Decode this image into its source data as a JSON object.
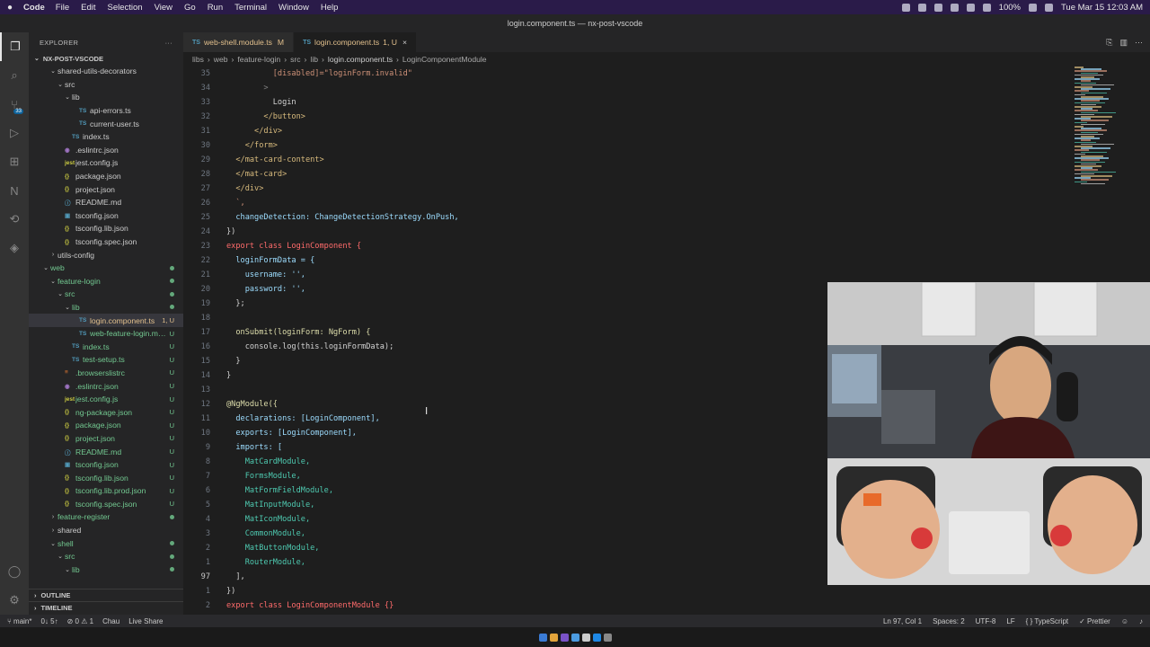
{
  "mac_menubar": {
    "app": "Code",
    "menus": [
      "File",
      "Edit",
      "Selection",
      "View",
      "Go",
      "Run",
      "Terminal",
      "Window",
      "Help"
    ],
    "battery": "100%",
    "clock": "Tue Mar 15  12:03 AM"
  },
  "window_title": "login.component.ts — nx-post-vscode",
  "activity_bar": {
    "scm_badge": "33",
    "items": [
      "files-icon",
      "search-icon",
      "source-control-icon",
      "run-debug-icon",
      "extensions-icon",
      "nx-icon",
      "remote-icon",
      "docker-icon"
    ]
  },
  "sidebar": {
    "title": "EXPLORER",
    "project": "NX-POST-VSCODE",
    "rows": [
      {
        "indent": 1,
        "type": "folder",
        "open": true,
        "name": "shared-utils-decorators",
        "badge": "",
        "status": ""
      },
      {
        "indent": 2,
        "type": "folder",
        "open": true,
        "name": "src",
        "badge": "",
        "status": ""
      },
      {
        "indent": 3,
        "type": "folder",
        "open": true,
        "name": "lib",
        "badge": "",
        "status": ""
      },
      {
        "indent": 4,
        "type": "ts",
        "name": "api-errors.ts",
        "badge": "",
        "status": ""
      },
      {
        "indent": 4,
        "type": "ts",
        "name": "current-user.ts",
        "badge": "",
        "status": ""
      },
      {
        "indent": 3,
        "type": "ts",
        "name": "index.ts",
        "badge": "",
        "status": ""
      },
      {
        "indent": 2,
        "type": "eslint",
        "name": ".eslintrc.json",
        "badge": "",
        "status": ""
      },
      {
        "indent": 2,
        "type": "jest",
        "name": "jest.config.js",
        "badge": "",
        "status": ""
      },
      {
        "indent": 2,
        "type": "json",
        "name": "package.json",
        "badge": "",
        "status": ""
      },
      {
        "indent": 2,
        "type": "json",
        "name": "project.json",
        "badge": "",
        "status": ""
      },
      {
        "indent": 2,
        "type": "md",
        "name": "README.md",
        "badge": "",
        "status": ""
      },
      {
        "indent": 2,
        "type": "tsconfig",
        "name": "tsconfig.json",
        "badge": "",
        "status": ""
      },
      {
        "indent": 2,
        "type": "json",
        "name": "tsconfig.lib.json",
        "badge": "",
        "status": ""
      },
      {
        "indent": 2,
        "type": "json",
        "name": "tsconfig.spec.json",
        "badge": "",
        "status": ""
      },
      {
        "indent": 1,
        "type": "folder",
        "open": false,
        "name": "utils-config",
        "badge": "",
        "status": ""
      },
      {
        "indent": 0,
        "type": "folder",
        "open": true,
        "name": "web",
        "badge": "",
        "status": "new"
      },
      {
        "indent": 1,
        "type": "folder",
        "open": true,
        "name": "feature-login",
        "badge": "",
        "status": "new"
      },
      {
        "indent": 2,
        "type": "folder",
        "open": true,
        "name": "src",
        "badge": "",
        "status": "new"
      },
      {
        "indent": 3,
        "type": "folder",
        "open": true,
        "name": "lib",
        "badge": "",
        "status": "new"
      },
      {
        "indent": 4,
        "type": "ts",
        "name": "login.component.ts",
        "badge": "1, U",
        "status": "mod",
        "selected": true
      },
      {
        "indent": 4,
        "type": "ts",
        "name": "web-feature-login.mod...",
        "badge": "U",
        "status": "new"
      },
      {
        "indent": 3,
        "type": "ts",
        "name": "index.ts",
        "badge": "U",
        "status": "new"
      },
      {
        "indent": 3,
        "type": "ts",
        "name": "test-setup.ts",
        "badge": "U",
        "status": "new"
      },
      {
        "indent": 2,
        "type": "browserslist",
        "name": ".browserslistrc",
        "badge": "U",
        "status": "new"
      },
      {
        "indent": 2,
        "type": "eslint",
        "name": ".eslintrc.json",
        "badge": "U",
        "status": "new"
      },
      {
        "indent": 2,
        "type": "jest",
        "name": "jest.config.js",
        "badge": "U",
        "status": "new"
      },
      {
        "indent": 2,
        "type": "json",
        "name": "ng-package.json",
        "badge": "U",
        "status": "new"
      },
      {
        "indent": 2,
        "type": "json",
        "name": "package.json",
        "badge": "U",
        "status": "new"
      },
      {
        "indent": 2,
        "type": "json",
        "name": "project.json",
        "badge": "U",
        "status": "new"
      },
      {
        "indent": 2,
        "type": "md",
        "name": "README.md",
        "badge": "U",
        "status": "new"
      },
      {
        "indent": 2,
        "type": "tsconfig",
        "name": "tsconfig.json",
        "badge": "U",
        "status": "new"
      },
      {
        "indent": 2,
        "type": "json",
        "name": "tsconfig.lib.json",
        "badge": "U",
        "status": "new"
      },
      {
        "indent": 2,
        "type": "json",
        "name": "tsconfig.lib.prod.json",
        "badge": "U",
        "status": "new"
      },
      {
        "indent": 2,
        "type": "json",
        "name": "tsconfig.spec.json",
        "badge": "U",
        "status": "new"
      },
      {
        "indent": 1,
        "type": "folder",
        "open": false,
        "name": "feature-register",
        "badge": "",
        "status": "new"
      },
      {
        "indent": 1,
        "type": "folder",
        "open": false,
        "name": "shared",
        "badge": "",
        "status": ""
      },
      {
        "indent": 1,
        "type": "folder",
        "open": true,
        "name": "shell",
        "badge": "",
        "status": "new"
      },
      {
        "indent": 2,
        "type": "folder",
        "open": true,
        "name": "src",
        "badge": "",
        "status": "new"
      },
      {
        "indent": 3,
        "type": "folder",
        "open": true,
        "name": "lib",
        "badge": "",
        "status": "new"
      }
    ],
    "outline": "OUTLINE",
    "timeline": "TIMELINE"
  },
  "tabs": [
    {
      "icon": "TS",
      "name": "web-shell.module.ts",
      "badge": "M",
      "active": false
    },
    {
      "icon": "TS",
      "name": "login.component.ts",
      "badge": "1, U",
      "active": true
    }
  ],
  "breadcrumbs": [
    "libs",
    "web",
    "feature-login",
    "src",
    "lib",
    "login.component.ts",
    "LoginComponentModule"
  ],
  "editor": {
    "lines": [
      {
        "n": "35",
        "code": "          [disabled]=\"loginForm.invalid\"",
        "color": "#ce9178"
      },
      {
        "n": "34",
        "code": "        >",
        "color": "#808080"
      },
      {
        "n": "33",
        "code": "          Login",
        "color": "#d4d4d4"
      },
      {
        "n": "32",
        "code": "        </button>",
        "color": "#d7ba7d"
      },
      {
        "n": "31",
        "code": "      </div>",
        "color": "#d7ba7d"
      },
      {
        "n": "30",
        "code": "    </form>",
        "color": "#d7ba7d"
      },
      {
        "n": "29",
        "code": "  </mat-card-content>",
        "color": "#d7ba7d"
      },
      {
        "n": "28",
        "code": "  </mat-card>",
        "color": "#d7ba7d"
      },
      {
        "n": "27",
        "code": "  </div>",
        "color": "#d7ba7d"
      },
      {
        "n": "26",
        "code": "  `,",
        "color": "#ce9178"
      },
      {
        "n": "25",
        "code": "  changeDetection: ChangeDetectionStrategy.OnPush,",
        "color": "#9cdcfe"
      },
      {
        "n": "24",
        "code": "})",
        "color": "#d4d4d4"
      },
      {
        "n": "23",
        "code": "export class LoginComponent {",
        "color": "#ff6b6b"
      },
      {
        "n": "22",
        "code": "  loginFormData = {",
        "color": "#9cdcfe"
      },
      {
        "n": "21",
        "code": "    username: '',",
        "color": "#9cdcfe"
      },
      {
        "n": "20",
        "code": "    password: '',",
        "color": "#9cdcfe"
      },
      {
        "n": "19",
        "code": "  };",
        "color": "#d4d4d4"
      },
      {
        "n": "18",
        "code": "",
        "color": "#d4d4d4"
      },
      {
        "n": "17",
        "code": "  onSubmit(loginForm: NgForm) {",
        "color": "#dcdcaa"
      },
      {
        "n": "16",
        "code": "    console.log(this.loginFormData);",
        "color": "#d4d4d4"
      },
      {
        "n": "15",
        "code": "  }",
        "color": "#d4d4d4"
      },
      {
        "n": "14",
        "code": "}",
        "color": "#d4d4d4"
      },
      {
        "n": "13",
        "code": "",
        "color": "#d4d4d4"
      },
      {
        "n": "12",
        "code": "@NgModule({",
        "color": "#dcdcaa"
      },
      {
        "n": "11",
        "code": "  declarations: [LoginComponent],",
        "color": "#9cdcfe"
      },
      {
        "n": "10",
        "code": "  exports: [LoginComponent],",
        "color": "#9cdcfe"
      },
      {
        "n": "9",
        "code": "  imports: [",
        "color": "#9cdcfe"
      },
      {
        "n": "8",
        "code": "    MatCardModule,",
        "color": "#4ec9b0"
      },
      {
        "n": "7",
        "code": "    FormsModule,",
        "color": "#4ec9b0"
      },
      {
        "n": "6",
        "code": "    MatFormFieldModule,",
        "color": "#4ec9b0"
      },
      {
        "n": "5",
        "code": "    MatInputModule,",
        "color": "#4ec9b0"
      },
      {
        "n": "4",
        "code": "    MatIconModule,",
        "color": "#4ec9b0"
      },
      {
        "n": "3",
        "code": "    CommonModule,",
        "color": "#4ec9b0"
      },
      {
        "n": "2",
        "code": "    MatButtonModule,",
        "color": "#4ec9b0"
      },
      {
        "n": "1",
        "code": "    RouterModule,",
        "color": "#4ec9b0"
      },
      {
        "n": "97",
        "code": "  ],",
        "color": "#d4d4d4",
        "current": true
      },
      {
        "n": "1",
        "code": "})",
        "color": "#d4d4d4"
      },
      {
        "n": "2",
        "code": "export class LoginComponentModule {}",
        "color": "#ff6b6b"
      }
    ]
  },
  "statusbar": {
    "branch": "main*",
    "sync": "0↓ 5↑",
    "problems": "⊘ 0 ⚠ 1",
    "user": "Chau",
    "live_share": "Live Share",
    "position": "Ln 97, Col 1",
    "spaces": "Spaces: 2",
    "encoding": "UTF-8",
    "eol": "LF",
    "language": "{ } TypeScript",
    "formatter": "✓ Prettier"
  },
  "colors": {
    "accent": "#007acc",
    "modified": "#e2c08d",
    "untracked": "#73c991"
  }
}
